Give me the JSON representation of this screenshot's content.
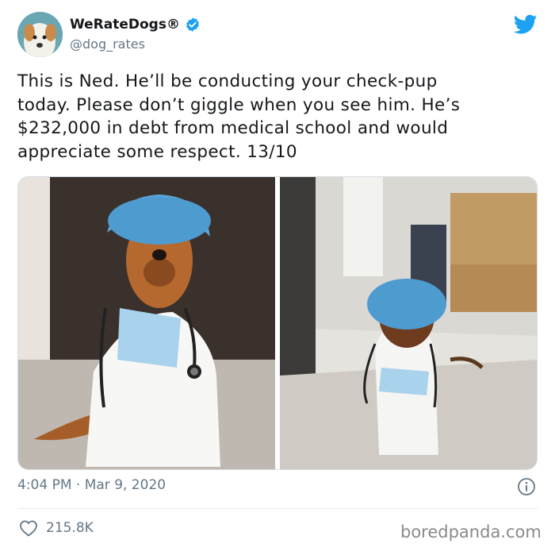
{
  "account": {
    "name": "WeRateDogs®",
    "handle": "@dog_rates",
    "verified": true
  },
  "tweet": {
    "lines": [
      "This is Ned. He’ll be conducting your check-pup",
      "today. Please don’t giggle when you see him. He’s",
      "$232,000 in debt from medical school and would",
      "appreciate some respect. 13/10"
    ]
  },
  "footer": {
    "timestamp": "4:04 PM · Mar 9, 2020",
    "likes": "215.8K"
  },
  "watermark": "boredpanda.com",
  "icons": {
    "verified": "verified-badge-icon",
    "twitter": "twitter-bird-icon",
    "info": "info-icon",
    "like": "heart-icon"
  },
  "colors": {
    "twitter_blue": "#1da1f2",
    "muted_text": "#657786",
    "text": "#14171a"
  }
}
